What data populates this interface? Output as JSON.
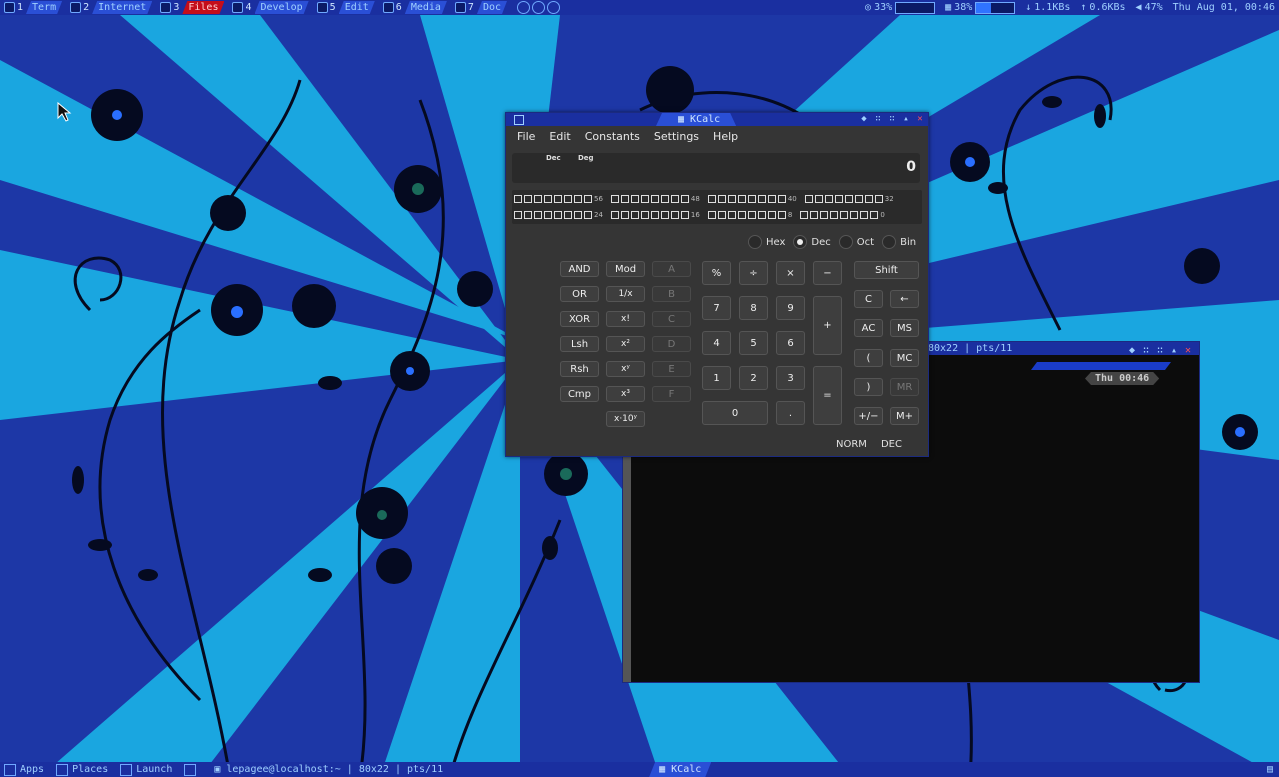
{
  "top_panel": {
    "workspaces": [
      {
        "num": "1",
        "label": "Term",
        "active": false
      },
      {
        "num": "2",
        "label": "Internet",
        "active": false
      },
      {
        "num": "3",
        "label": "Files",
        "active": true
      },
      {
        "num": "4",
        "label": "Develop",
        "active": false
      },
      {
        "num": "5",
        "label": "Edit",
        "active": false
      },
      {
        "num": "6",
        "label": "Media",
        "active": false
      },
      {
        "num": "7",
        "label": "Doc",
        "active": false
      }
    ],
    "cpu": "33%",
    "mem": "38%",
    "mem_fraction": 0.38,
    "net_down": "1.1KBs",
    "net_up": "0.6KBs",
    "volume": "47%",
    "datetime": "Thu Aug 01, 00:46"
  },
  "bottom_panel": {
    "apps": "Apps",
    "places": "Places",
    "launch": "Launch",
    "task_terminal": "lepagee@localhost:~ | 80x22 | pts/11",
    "task_kcalc": "KCalc"
  },
  "terminal": {
    "title": "80x22 | pts/11",
    "clock": "Thu 00:46"
  },
  "kcalc": {
    "title": "KCalc",
    "menu": [
      "File",
      "Edit",
      "Constants",
      "Settings",
      "Help"
    ],
    "indicators": [
      "Dec",
      "Deg"
    ],
    "display_value": "0",
    "bit_labels_row1": [
      "56",
      "48",
      "40",
      "32"
    ],
    "bit_labels_row2": [
      "24",
      "16",
      "8",
      "0"
    ],
    "bases": [
      {
        "label": "Hex",
        "selected": false
      },
      {
        "label": "Dec",
        "selected": true
      },
      {
        "label": "Oct",
        "selected": false
      },
      {
        "label": "Bin",
        "selected": false
      }
    ],
    "logic_keys": [
      "AND",
      "OR",
      "XOR",
      "Lsh",
      "Rsh",
      "Cmp"
    ],
    "func_keys": [
      "Mod",
      "1/x",
      "x!",
      "x²",
      "xʸ",
      "x³",
      "x·10ʸ"
    ],
    "hex_keys": [
      "A",
      "B",
      "C",
      "D",
      "E",
      "F"
    ],
    "ops": {
      "percent": "%",
      "divide": "÷",
      "multiply": "×",
      "minus": "−",
      "plus": "+",
      "equals": "=",
      "dot": "."
    },
    "digits": [
      "7",
      "8",
      "9",
      "4",
      "5",
      "6",
      "1",
      "2",
      "3",
      "0"
    ],
    "right_keys": {
      "shift": "Shift",
      "clear": "C",
      "backspace": "←",
      "ac": "AC",
      "ms": "MS",
      "lparen": "(",
      "mc": "MC",
      "rparen": ")",
      "mr": "MR",
      "plusminus": "+/−",
      "mplus": "M+"
    },
    "status": [
      "NORM",
      "DEC"
    ]
  }
}
